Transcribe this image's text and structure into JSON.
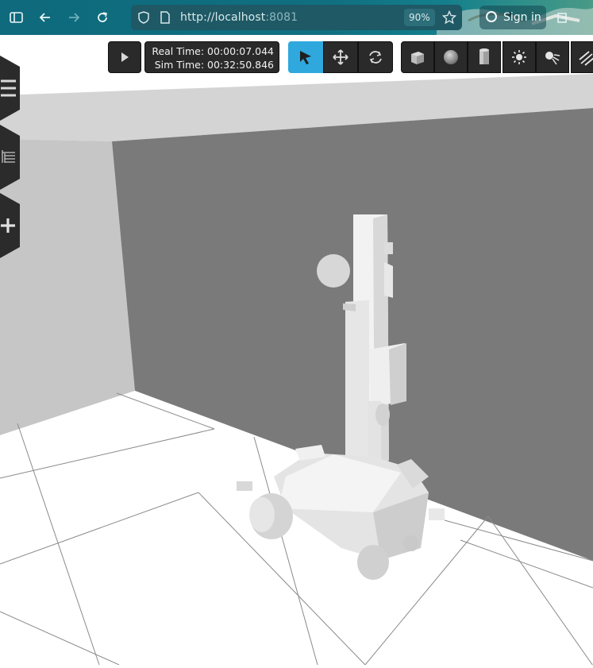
{
  "browser": {
    "url_host": "http://localhost",
    "url_port": ":8081",
    "zoom": "90%",
    "sign_in_label": "Sign in"
  },
  "toolbar": {
    "real_time": "Real Time: 00:00:07.044",
    "sim_time": "Sim Time: 00:32:50.846",
    "play_icon": "play-icon",
    "tools": [
      "select-arrow-icon",
      "translate-icon",
      "rotate-icon"
    ],
    "insert": [
      "box-icon",
      "sphere-icon",
      "cylinder-icon",
      "point-light-icon",
      "spot-light-icon",
      "directional-light-icon"
    ]
  },
  "side_tabs": [
    "menu-icon",
    "model-tree-icon",
    "insert-plus-icon"
  ],
  "colors": {
    "accent": "#2fa8dd",
    "toolbar_bg": "#2a2a2a",
    "wall": "#7a7a7a"
  }
}
